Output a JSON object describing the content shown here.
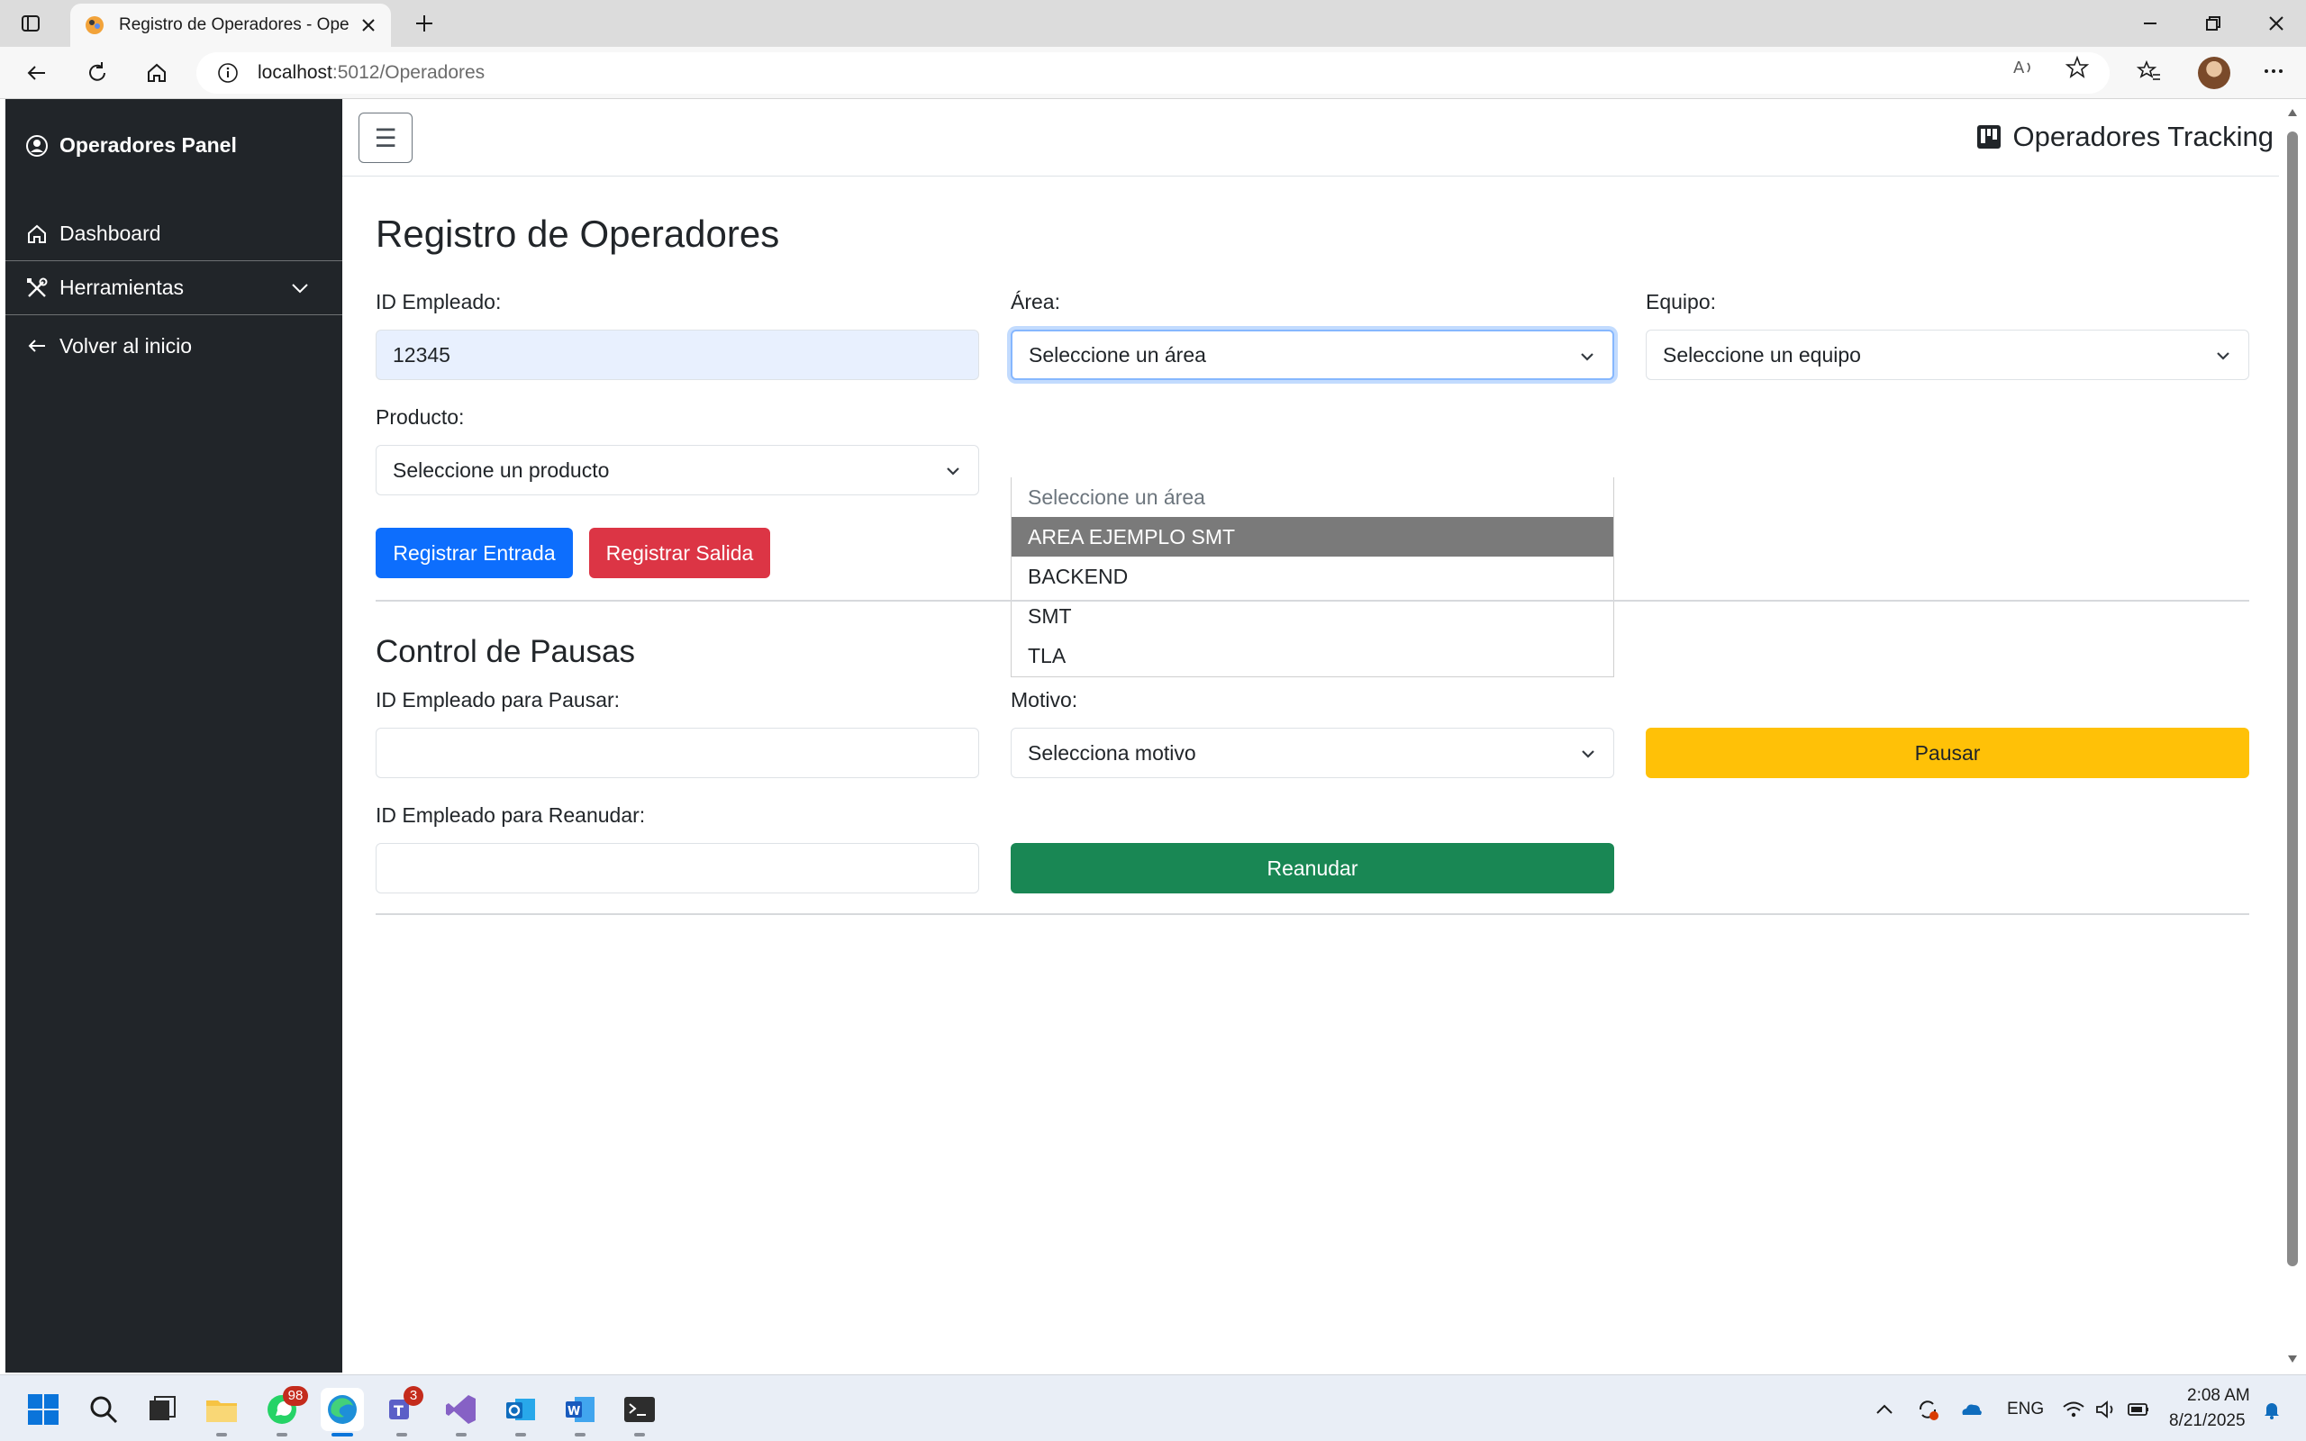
{
  "browser": {
    "tab_title": "Registro de Operadores - Operad",
    "url_host": "localhost",
    "url_path": ":5012/Operadores"
  },
  "sidebar": {
    "brand": "Operadores Panel",
    "items": [
      {
        "label": "Dashboard",
        "icon": "home-icon"
      },
      {
        "label": "Herramientas",
        "icon": "tools-icon"
      },
      {
        "label": "Volver al inicio",
        "icon": "arrow-left-icon"
      }
    ]
  },
  "topnav": {
    "menu_glyph": "☰",
    "brand": "Operadores Tracking"
  },
  "registro": {
    "title": "Registro de Operadores",
    "id_label": "ID Empleado:",
    "id_value": "12345",
    "area_label": "Área:",
    "area_value": "Seleccione un área",
    "equipo_label": "Equipo:",
    "equipo_value": "Seleccione un equipo",
    "producto_label": "Producto:",
    "producto_value": "Seleccione un producto",
    "btn_entrada": "Registrar Entrada",
    "btn_salida": "Registrar Salida",
    "area_options": [
      "Seleccione un área",
      "AREA EJEMPLO SMT",
      "BACKEND",
      "SMT",
      "TLA"
    ],
    "area_highlighted": "AREA EJEMPLO SMT"
  },
  "pausas": {
    "title": "Control de Pausas",
    "pausar_label": "ID Empleado para Pausar:",
    "pausar_value": "",
    "motivo_label": "Motivo:",
    "motivo_value": "Selecciona motivo",
    "btn_pausar": "Pausar",
    "reanudar_label": "ID Empleado para Reanudar:",
    "reanudar_value": "",
    "btn_reanudar": "Reanudar"
  },
  "colors": {
    "sidebar_bg": "#212529",
    "primary": "#0d6efd",
    "danger": "#dc3545",
    "warning": "#ffc107",
    "success": "#198754"
  },
  "taskbar": {
    "whatsapp_badge": "98",
    "teams_badge": "3",
    "language": "ENG",
    "time": "2:08 AM",
    "date": "8/21/2025"
  }
}
